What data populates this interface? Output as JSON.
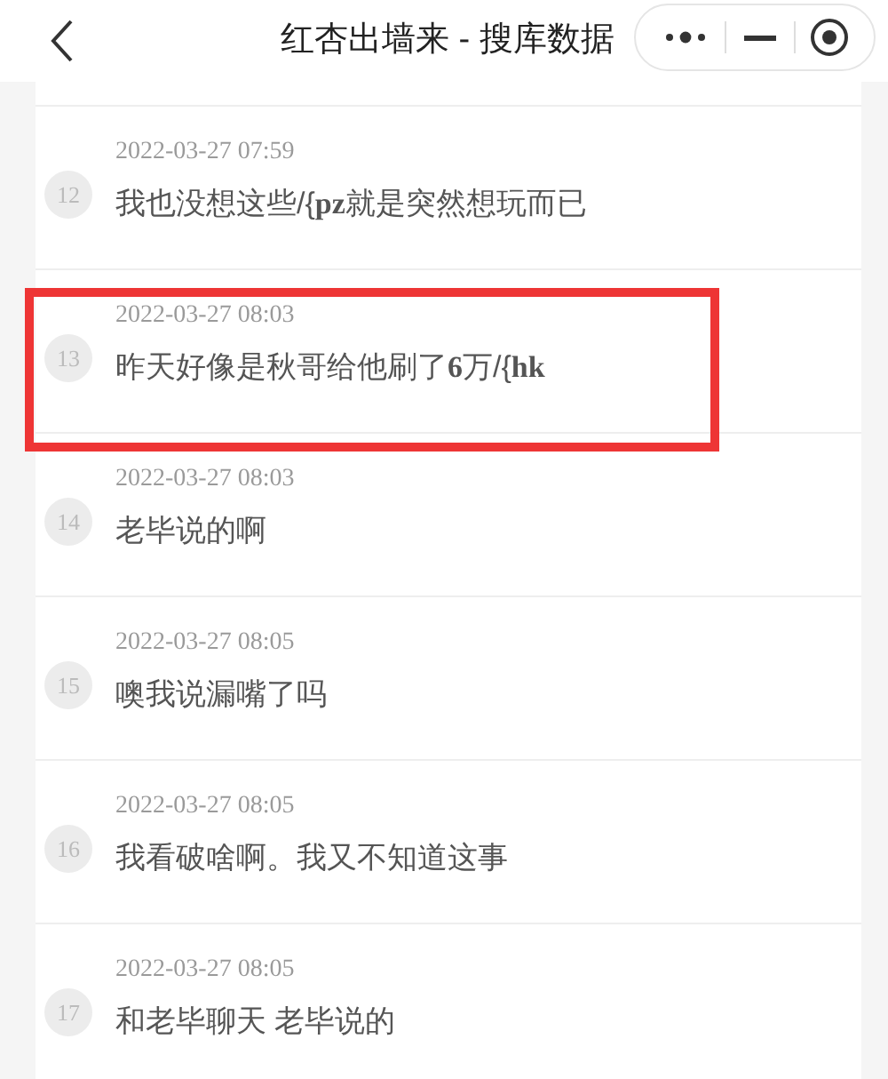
{
  "header": {
    "title": "红杏出墙来 - 搜库数据"
  },
  "messages": [
    {
      "index": "12",
      "time": "2022-03-27 07:59",
      "text": "我也没想这些/{**pz**就是突然想玩而已",
      "highlighted": false
    },
    {
      "index": "13",
      "time": "2022-03-27 08:03",
      "text": "昨天好像是秋哥给他刷了**6**万/{**hk**",
      "highlighted": true
    },
    {
      "index": "14",
      "time": "2022-03-27 08:03",
      "text": "老毕说的啊",
      "highlighted": false
    },
    {
      "index": "15",
      "time": "2022-03-27 08:05",
      "text": "噢我说漏嘴了吗",
      "highlighted": false
    },
    {
      "index": "16",
      "time": "2022-03-27 08:05",
      "text": "我看破啥啊。我又不知道这事",
      "highlighted": false
    },
    {
      "index": "17",
      "time": "2022-03-27 08:05",
      "text": "和老毕聊天 老毕说的",
      "highlighted": false
    }
  ]
}
